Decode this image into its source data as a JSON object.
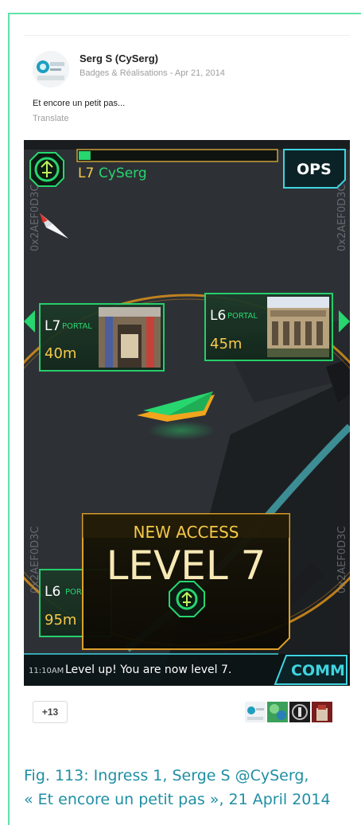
{
  "post": {
    "author": "Serg S (CySerg)",
    "category": "Badges & Réalisations",
    "separator": "-",
    "date": "Apr 21, 2014",
    "text": "Et encore un petit pas...",
    "translate_label": "Translate",
    "plus_count": "+13"
  },
  "game": {
    "agent_level": "L7",
    "agent_name": "CySerg",
    "ops_label": "OPS",
    "watermark": "0x2AEF0D3C",
    "portals": [
      {
        "level": "L7",
        "tag": "PORTAL",
        "distance": "40m"
      },
      {
        "level": "L6",
        "tag": "PORTAL",
        "distance": "45m"
      },
      {
        "level": "L6",
        "tag": "POR",
        "distance": "95m"
      }
    ],
    "levelup": {
      "heading": "NEW ACCESS",
      "title": "LEVEL 7"
    },
    "comm": {
      "time": "11:10AM",
      "message": "Level up! You are now level 7.",
      "label": "COMM"
    },
    "xp_fraction": 0.06
  },
  "caption": {
    "line1": "Fig. 113: Ingress 1, Serge S @CySerg,",
    "line2": "« Et encore un petit pas », 21 April 2014"
  },
  "colors": {
    "accent": "#1f8fa3",
    "frame": "#5fe3a8",
    "enl_green": "#27d66e",
    "hud_cyan": "#3fd4e0",
    "gold": "#f5a11a"
  }
}
